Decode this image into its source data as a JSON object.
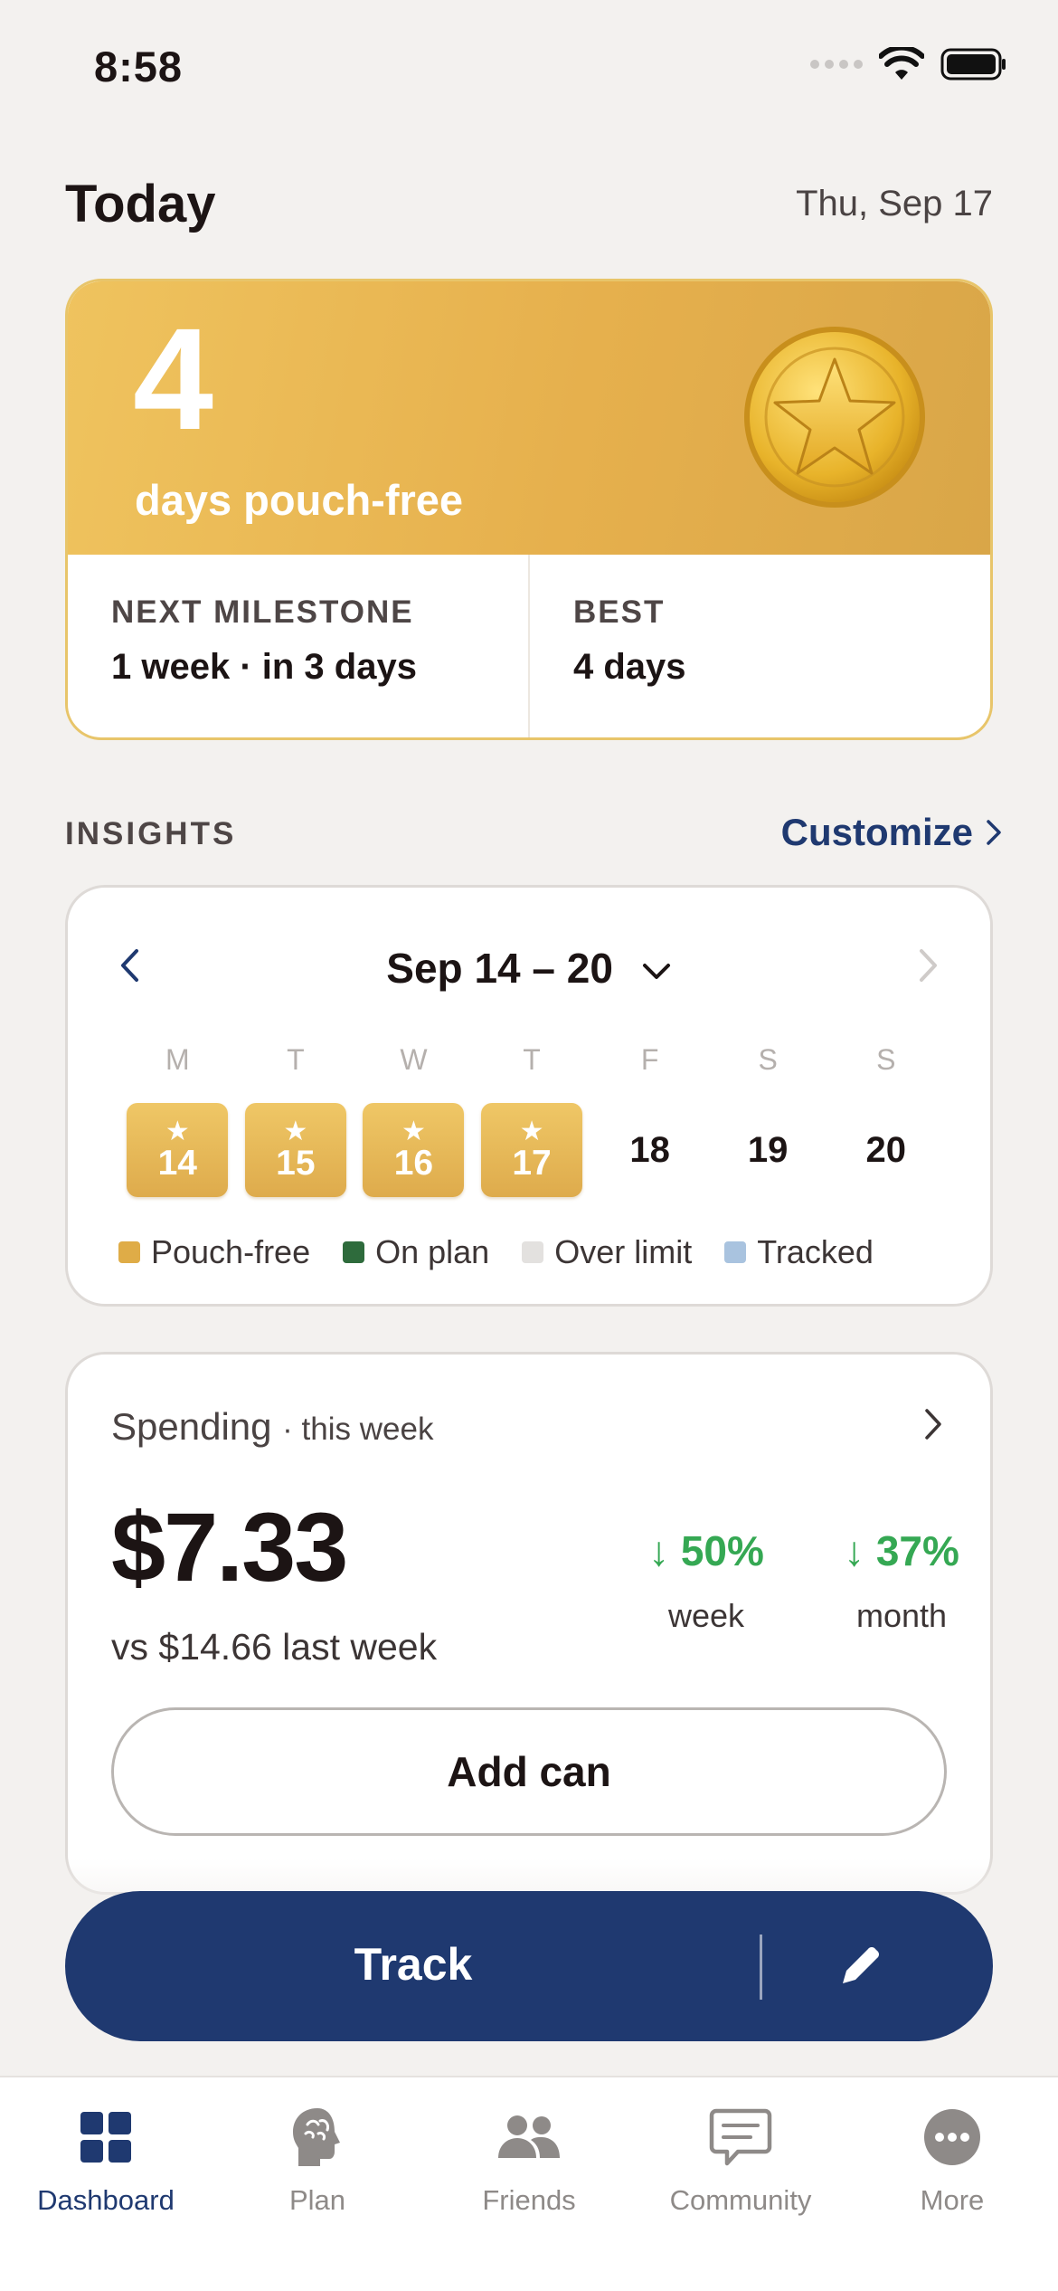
{
  "status_bar": {
    "time": "8:58"
  },
  "header": {
    "title": "Today",
    "date": "Thu, Sep 17"
  },
  "streak": {
    "count": "4",
    "label": "days pouch-free",
    "next_milestone_label": "NEXT MILESTONE",
    "next_milestone_value": "1 week · in 3 days",
    "best_label": "BEST",
    "best_value": "4 days"
  },
  "insights": {
    "section_label": "INSIGHTS",
    "customize_label": "Customize",
    "week_range": "Sep 14 – 20",
    "day_letters": [
      "M",
      "T",
      "W",
      "T",
      "F",
      "S",
      "S"
    ],
    "days": [
      {
        "date": "14",
        "status": "pouch-free"
      },
      {
        "date": "15",
        "status": "pouch-free"
      },
      {
        "date": "16",
        "status": "pouch-free"
      },
      {
        "date": "17",
        "status": "pouch-free"
      },
      {
        "date": "18",
        "status": "none"
      },
      {
        "date": "19",
        "status": "none"
      },
      {
        "date": "20",
        "status": "none"
      }
    ],
    "legend": [
      {
        "label": "Pouch-free",
        "color": "#dfac47"
      },
      {
        "label": "On plan",
        "color": "#2e6b3c"
      },
      {
        "label": "Over limit",
        "color": "#e3e1df"
      },
      {
        "label": "Tracked",
        "color": "#a9c3df"
      }
    ]
  },
  "spending": {
    "title": "Spending",
    "period": "· this week",
    "amount": "$7.33",
    "comparison": "vs $14.66 last week",
    "week_change": "↓ 50%",
    "week_label": "week",
    "month_change": "↓ 37%",
    "month_label": "month",
    "add_button": "Add can"
  },
  "track_button": {
    "label": "Track"
  },
  "tabbar": {
    "items": [
      {
        "label": "Dashboard",
        "icon": "dashboard-icon",
        "active": true
      },
      {
        "label": "Plan",
        "icon": "brain-icon",
        "active": false
      },
      {
        "label": "Friends",
        "icon": "friends-icon",
        "active": false
      },
      {
        "label": "Community",
        "icon": "chat-icon",
        "active": false
      },
      {
        "label": "More",
        "icon": "more-icon",
        "active": false
      }
    ]
  },
  "colors": {
    "accent_navy": "#1f3970",
    "gold": "#e6b04d",
    "positive_green": "#35a853",
    "background": "#f3f1ef"
  }
}
